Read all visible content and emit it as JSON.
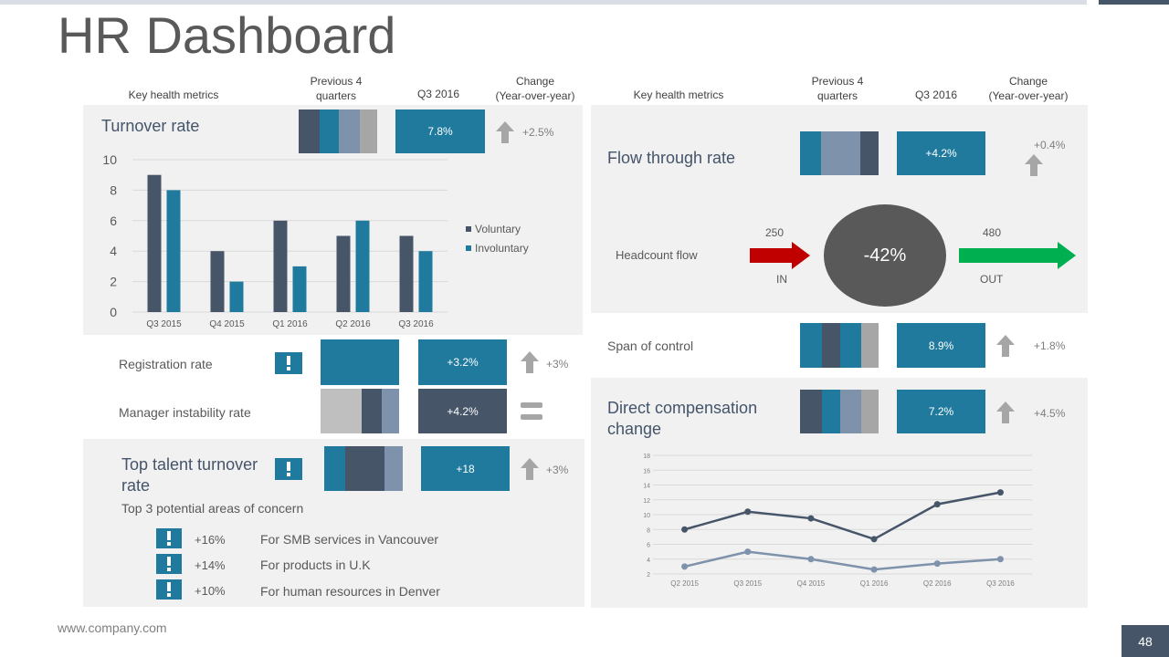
{
  "page": {
    "title": "HR Dashboard",
    "footer_url": "www.company.com",
    "page_number": "48"
  },
  "colors": {
    "dark": "#475569",
    "teal": "#1f7a9e",
    "slate": "#7f92ab",
    "gray": "#a6a6a6",
    "lightgray": "#bfbfbf",
    "arrow_in": "#c00000",
    "arrow_out": "#00b050",
    "circle": "#595959",
    "up_arrow": "#a6a6a6"
  },
  "headers": {
    "left": {
      "metrics": "Key health metrics",
      "prev": [
        "Previous 4",
        "quarters"
      ],
      "current": "Q3 2016",
      "change": [
        "Change",
        "(Year-over-year)"
      ]
    },
    "right": {
      "metrics": "Key health metrics",
      "prev": [
        "Previous 4",
        "quarters"
      ],
      "current": "Q3 2016",
      "change": [
        "Change",
        "(Year-over-year)"
      ]
    }
  },
  "turnover": {
    "label": "Turnover rate",
    "value": "7.8%",
    "change": "+2.5%"
  },
  "registration": {
    "label": "Registration rate",
    "value": "+3.2%",
    "change": "+3%"
  },
  "manager": {
    "label": "Manager instability rate",
    "value": "+4.2%"
  },
  "top_talent": {
    "label_lines": [
      "Top talent turnover",
      "rate"
    ],
    "value": "+18",
    "change": "+3%",
    "concern_title": "Top 3 potential areas of concern",
    "concerns": [
      {
        "pct": "+16%",
        "text": "For SMB services in Vancouver"
      },
      {
        "pct": "+14%",
        "text": "For products in U.K"
      },
      {
        "pct": "+10%",
        "text": "For human resources in Denver"
      }
    ]
  },
  "flow": {
    "label": "Flow through rate",
    "value": "+4.2%",
    "change": "+0.4%",
    "headcount_label": "Headcount flow",
    "in_value": "250",
    "in_label": "IN",
    "out_value": "480",
    "out_label": "OUT",
    "center": "-42%"
  },
  "span": {
    "label": "Span of control",
    "value": "8.9%",
    "change": "+1.8%"
  },
  "comp": {
    "label_lines": [
      "Direct compensation",
      "change"
    ],
    "value": "7.2%",
    "change": "+4.5%"
  },
  "chart_data": [
    {
      "type": "bar",
      "categories": [
        "Q3 2015",
        "Q4 2015",
        "Q1 2016",
        "Q2 2016",
        "Q3 2016"
      ],
      "series": [
        {
          "name": "Voluntary",
          "values": [
            9,
            4,
            6,
            5,
            5
          ],
          "color": "#475569"
        },
        {
          "name": "Involuntary",
          "values": [
            8,
            2,
            3,
            6,
            4
          ],
          "color": "#1f7a9e"
        }
      ],
      "ylim": [
        0,
        10
      ],
      "yticks": [
        0,
        2,
        4,
        6,
        8,
        10
      ],
      "grid": true,
      "legend": "right"
    },
    {
      "type": "line",
      "categories": [
        "Q2 2015",
        "Q3 2015",
        "Q4 2015",
        "Q1 2016",
        "Q2 2016",
        "Q3 2016"
      ],
      "series": [
        {
          "values": [
            8,
            10.4,
            9.5,
            6.7,
            11.4,
            13
          ],
          "color": "#475569"
        },
        {
          "values": [
            3,
            5,
            4,
            2.6,
            3.4,
            4
          ],
          "color": "#7f92ab"
        }
      ],
      "ylim": [
        2,
        18
      ],
      "yticks": [
        2,
        4,
        6,
        8,
        10,
        12,
        14,
        16,
        18
      ],
      "grid": true
    }
  ]
}
